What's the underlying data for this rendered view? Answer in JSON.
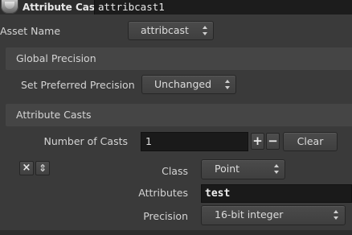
{
  "header": {
    "node_type": "Attribute Cast",
    "node_name": "attribcast1"
  },
  "asset_name": {
    "label": "Asset Name",
    "value": "attribcast"
  },
  "global_precision": {
    "title": "Global Precision",
    "preferred_label": "Set Preferred Precision",
    "preferred_value": "Unchanged"
  },
  "attribute_casts": {
    "title": "Attribute Casts",
    "num_casts_label": "Number of Casts",
    "num_casts_value": "1",
    "add_symbol": "+",
    "remove_symbol": "−",
    "clear_label": "Clear",
    "remove_instance_symbol": "×",
    "move_instance_symbol": "⇕",
    "class_label": "Class",
    "class_value": "Point",
    "attributes_label": "Attributes",
    "attributes_value": "test",
    "precision_label": "Precision",
    "precision_value": "16-bit integer"
  },
  "icons": [
    "node-icon",
    "dropdown-arrows-icon",
    "close-icon",
    "move-icon"
  ]
}
